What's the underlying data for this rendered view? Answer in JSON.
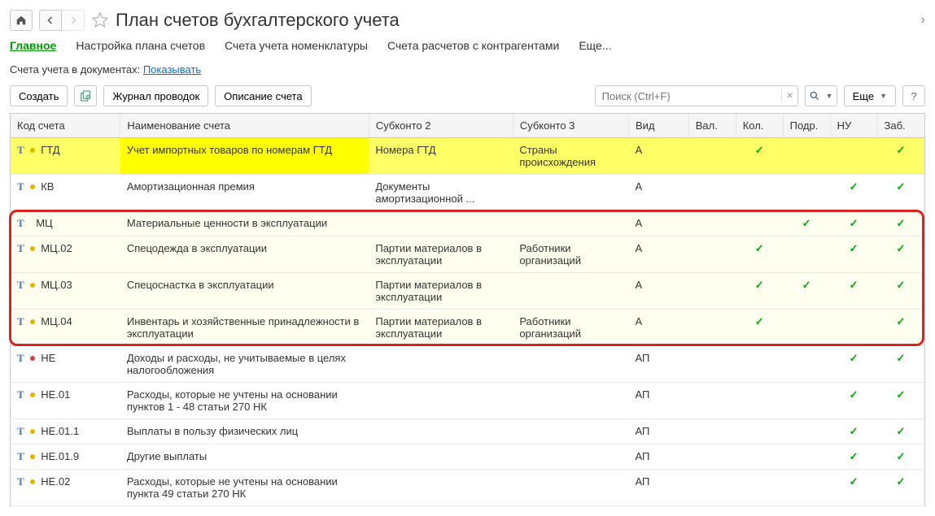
{
  "header": {
    "title": "План счетов бухгалтерского учета"
  },
  "tabs": [
    "Главное",
    "Настройка плана счетов",
    "Счета учета номенклатуры",
    "Счета расчетов с контрагентами",
    "Еще..."
  ],
  "docline": {
    "prefix": "Счета учета в документах: ",
    "link": "Показывать"
  },
  "toolbar": {
    "create": "Создать",
    "journal": "Журнал проводок",
    "desc": "Описание счета",
    "search_placeholder": "Поиск (Ctrl+F)",
    "more": "Еще"
  },
  "columns": [
    "Код счета",
    "Наименование счета",
    "Субконто 2",
    "Субконто 3",
    "Вид",
    "Вал.",
    "Кол.",
    "Подр.",
    "НУ",
    "Заб."
  ],
  "rows": [
    {
      "icon": "y",
      "code": "ГТД",
      "name": "Учет импортных товаров по номерам ГТД",
      "sub2": "Номера ГТД",
      "sub3": "Страны происхождения",
      "vid": "А",
      "kol": true,
      "zab": true,
      "sel": true
    },
    {
      "icon": "y",
      "code": "КВ",
      "name": "Амортизационная премия",
      "sub2": "Документы амортизационной ...",
      "sub3": "",
      "vid": "А",
      "nu": true,
      "zab": true
    },
    {
      "icon": "",
      "code": "МЦ",
      "name": "Материальные ценности в эксплуатации",
      "sub2": "",
      "sub3": "",
      "vid": "А",
      "podr": true,
      "nu": true,
      "zab": true,
      "alt": true,
      "box": "start"
    },
    {
      "icon": "y",
      "code": "МЦ.02",
      "name": "Спецодежда в эксплуатации",
      "sub2": "Партии материалов в эксплуатации",
      "sub3": "Работники организаций",
      "vid": "А",
      "kol": true,
      "nu": true,
      "zab": true,
      "alt": true
    },
    {
      "icon": "y",
      "code": "МЦ.03",
      "name": "Спецоснастка в эксплуатации",
      "sub2": "Партии материалов в эксплуатации",
      "sub3": "",
      "vid": "А",
      "kol": true,
      "podr": true,
      "nu": true,
      "zab": true,
      "alt": true
    },
    {
      "icon": "y",
      "code": "МЦ.04",
      "name": "Инвентарь и хозяйственные принадлежности в эксплуатации",
      "sub2": "Партии материалов в эксплуатации",
      "sub3": "Работники организаций",
      "vid": "А",
      "kol": true,
      "zab": true,
      "alt": true,
      "box": "end"
    },
    {
      "icon": "r",
      "code": "НЕ",
      "name": "Доходы и расходы, не учитываемые в целях налогообложения",
      "sub2": "",
      "sub3": "",
      "vid": "АП",
      "nu": true,
      "zab": true
    },
    {
      "icon": "y",
      "code": "НЕ.01",
      "name": "Расходы, которые не учтены на основании пунктов 1 - 48 статьи 270 НК",
      "sub2": "",
      "sub3": "",
      "vid": "АП",
      "nu": true,
      "zab": true
    },
    {
      "icon": "y",
      "code": "НЕ.01.1",
      "name": "Выплаты в пользу физических лиц",
      "sub2": "",
      "sub3": "",
      "vid": "АП",
      "nu": true,
      "zab": true
    },
    {
      "icon": "y",
      "code": "НЕ.01.9",
      "name": "Другие выплаты",
      "sub2": "",
      "sub3": "",
      "vid": "АП",
      "nu": true,
      "zab": true
    },
    {
      "icon": "y",
      "code": "НЕ.02",
      "name": "Расходы, которые не учтены на основании пункта 49 статьи 270 НК",
      "sub2": "",
      "sub3": "",
      "vid": "АП",
      "nu": true,
      "zab": true
    }
  ]
}
